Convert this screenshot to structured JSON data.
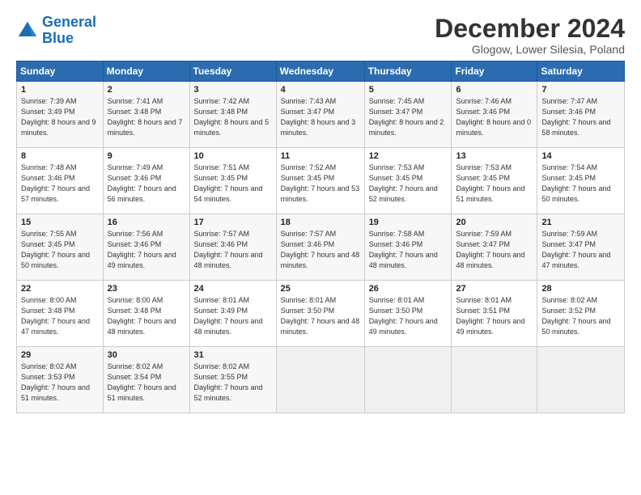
{
  "header": {
    "title": "December 2024",
    "subtitle": "Glogow, Lower Silesia, Poland"
  },
  "days_of_week": [
    "Sunday",
    "Monday",
    "Tuesday",
    "Wednesday",
    "Thursday",
    "Friday",
    "Saturday"
  ],
  "weeks": [
    [
      {
        "day": 1,
        "sunrise": "7:39 AM",
        "sunset": "3:49 PM",
        "daylight": "8 hours and 9 minutes."
      },
      {
        "day": 2,
        "sunrise": "7:41 AM",
        "sunset": "3:48 PM",
        "daylight": "8 hours and 7 minutes."
      },
      {
        "day": 3,
        "sunrise": "7:42 AM",
        "sunset": "3:48 PM",
        "daylight": "8 hours and 5 minutes."
      },
      {
        "day": 4,
        "sunrise": "7:43 AM",
        "sunset": "3:47 PM",
        "daylight": "8 hours and 3 minutes."
      },
      {
        "day": 5,
        "sunrise": "7:45 AM",
        "sunset": "3:47 PM",
        "daylight": "8 hours and 2 minutes."
      },
      {
        "day": 6,
        "sunrise": "7:46 AM",
        "sunset": "3:46 PM",
        "daylight": "8 hours and 0 minutes."
      },
      {
        "day": 7,
        "sunrise": "7:47 AM",
        "sunset": "3:46 PM",
        "daylight": "7 hours and 58 minutes."
      }
    ],
    [
      {
        "day": 8,
        "sunrise": "7:48 AM",
        "sunset": "3:46 PM",
        "daylight": "7 hours and 57 minutes."
      },
      {
        "day": 9,
        "sunrise": "7:49 AM",
        "sunset": "3:46 PM",
        "daylight": "7 hours and 56 minutes."
      },
      {
        "day": 10,
        "sunrise": "7:51 AM",
        "sunset": "3:45 PM",
        "daylight": "7 hours and 54 minutes."
      },
      {
        "day": 11,
        "sunrise": "7:52 AM",
        "sunset": "3:45 PM",
        "daylight": "7 hours and 53 minutes."
      },
      {
        "day": 12,
        "sunrise": "7:53 AM",
        "sunset": "3:45 PM",
        "daylight": "7 hours and 52 minutes."
      },
      {
        "day": 13,
        "sunrise": "7:53 AM",
        "sunset": "3:45 PM",
        "daylight": "7 hours and 51 minutes."
      },
      {
        "day": 14,
        "sunrise": "7:54 AM",
        "sunset": "3:45 PM",
        "daylight": "7 hours and 50 minutes."
      }
    ],
    [
      {
        "day": 15,
        "sunrise": "7:55 AM",
        "sunset": "3:45 PM",
        "daylight": "7 hours and 50 minutes."
      },
      {
        "day": 16,
        "sunrise": "7:56 AM",
        "sunset": "3:46 PM",
        "daylight": "7 hours and 49 minutes."
      },
      {
        "day": 17,
        "sunrise": "7:57 AM",
        "sunset": "3:46 PM",
        "daylight": "7 hours and 48 minutes."
      },
      {
        "day": 18,
        "sunrise": "7:57 AM",
        "sunset": "3:46 PM",
        "daylight": "7 hours and 48 minutes."
      },
      {
        "day": 19,
        "sunrise": "7:58 AM",
        "sunset": "3:46 PM",
        "daylight": "7 hours and 48 minutes."
      },
      {
        "day": 20,
        "sunrise": "7:59 AM",
        "sunset": "3:47 PM",
        "daylight": "7 hours and 48 minutes."
      },
      {
        "day": 21,
        "sunrise": "7:59 AM",
        "sunset": "3:47 PM",
        "daylight": "7 hours and 47 minutes."
      }
    ],
    [
      {
        "day": 22,
        "sunrise": "8:00 AM",
        "sunset": "3:48 PM",
        "daylight": "7 hours and 47 minutes."
      },
      {
        "day": 23,
        "sunrise": "8:00 AM",
        "sunset": "3:48 PM",
        "daylight": "7 hours and 48 minutes."
      },
      {
        "day": 24,
        "sunrise": "8:01 AM",
        "sunset": "3:49 PM",
        "daylight": "7 hours and 48 minutes."
      },
      {
        "day": 25,
        "sunrise": "8:01 AM",
        "sunset": "3:50 PM",
        "daylight": "7 hours and 48 minutes."
      },
      {
        "day": 26,
        "sunrise": "8:01 AM",
        "sunset": "3:50 PM",
        "daylight": "7 hours and 49 minutes."
      },
      {
        "day": 27,
        "sunrise": "8:01 AM",
        "sunset": "3:51 PM",
        "daylight": "7 hours and 49 minutes."
      },
      {
        "day": 28,
        "sunrise": "8:02 AM",
        "sunset": "3:52 PM",
        "daylight": "7 hours and 50 minutes."
      }
    ],
    [
      {
        "day": 29,
        "sunrise": "8:02 AM",
        "sunset": "3:53 PM",
        "daylight": "7 hours and 51 minutes."
      },
      {
        "day": 30,
        "sunrise": "8:02 AM",
        "sunset": "3:54 PM",
        "daylight": "7 hours and 51 minutes."
      },
      {
        "day": 31,
        "sunrise": "8:02 AM",
        "sunset": "3:55 PM",
        "daylight": "7 hours and 52 minutes."
      },
      null,
      null,
      null,
      null
    ]
  ]
}
